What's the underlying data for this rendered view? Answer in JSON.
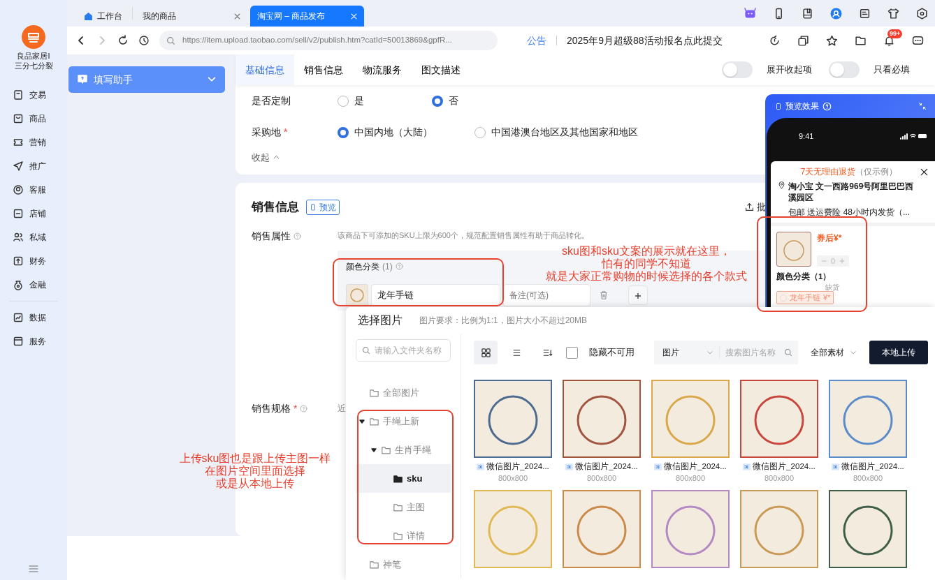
{
  "sidebar": {
    "shop_name": "良品家居I\n三分七分裂",
    "nav_groups": [
      {
        "items": [
          {
            "label": "交易"
          },
          {
            "label": "商品"
          },
          {
            "label": "营销"
          },
          {
            "label": "推广"
          },
          {
            "label": "客服"
          },
          {
            "label": "店铺"
          },
          {
            "label": "私域"
          },
          {
            "label": "财务"
          },
          {
            "label": "金融"
          }
        ]
      },
      {
        "items": [
          {
            "label": "数据"
          },
          {
            "label": "服务"
          }
        ]
      }
    ]
  },
  "browser_tabs": [
    {
      "label": "工作台",
      "selected": false,
      "pinned": true,
      "closable": false
    },
    {
      "label": "我的商品",
      "selected": false,
      "pinned": false,
      "closable": true
    },
    {
      "label": "淘宝网 – 商品发布",
      "selected": true,
      "pinned": false,
      "closable": true
    }
  ],
  "address_bar": {
    "url": "https://item.upload.taobao.com/sell/v2/publish.htm?catId=50013869&gpfR...",
    "forward_disabled": true,
    "notice_label": "公告",
    "notice_text": "2025年9月超级88活动报名点此提交",
    "badge": "99+"
  },
  "helper": {
    "label": "填写助手"
  },
  "form_tabs": [
    {
      "label": "基础信息",
      "selected": true
    },
    {
      "label": "销售信息",
      "selected": false
    },
    {
      "label": "物流服务",
      "selected": false
    },
    {
      "label": "图文描述",
      "selected": false
    }
  ],
  "toggles": [
    {
      "label": "展开收起项",
      "on": false
    },
    {
      "label": "只看必填",
      "on": false
    }
  ],
  "basic_fields": [
    {
      "label": "是否定制",
      "options": [
        {
          "label": "是",
          "selected": false
        },
        {
          "label": "否",
          "selected": true
        }
      ]
    },
    {
      "label": "采购地",
      "required_mark": "*",
      "options": [
        {
          "label": "中国内地（大陆）",
          "selected": true
        },
        {
          "label": "中国港澳台地区及其他国家和地区",
          "selected": false
        }
      ]
    }
  ],
  "collapse_label": "收起",
  "sales": {
    "title": "销售信息",
    "preview_button": "预览",
    "batch_label": "批",
    "attributes_label": "销售属性",
    "attributes_hint": "该商品下可添加的SKU上限为600个，规范配置销售属性有助于商品转化。",
    "group_title": "颜色分类",
    "group_count": "(1)",
    "sku_value": "龙年手链",
    "note_placeholder": "备注(可选)",
    "specs_label": "销售规格",
    "specs_required_mark": "*",
    "specs_hint": "近"
  },
  "preview": {
    "title": "预览效果",
    "time": "9:41",
    "return_policy": "7天无理由退货",
    "return_note": "（仅示例）",
    "address": "淘小宝 文一西路969号阿里巴巴西溪园区",
    "shipping": "包邮 送运费险 48小时内发货（...",
    "price": "券后¥*",
    "quantity": "0",
    "group_title": "颜色分类（1）",
    "chip_label": "龙年手链",
    "chip_price": "¥*",
    "stock_note": "缺货"
  },
  "dialog": {
    "title": "选择图片",
    "requirement": "图片要求：比例为1:1，图片大小不超过20MB",
    "folder_search_placeholder": "请输入文件夹名称",
    "folders": [
      {
        "label": "全部图片",
        "selected": false
      },
      {
        "label": "手绳上新",
        "selected": false,
        "expanded": true,
        "children": [
          {
            "label": "生肖手绳",
            "selected": false,
            "expanded": true,
            "children": [
              {
                "label": "sku",
                "selected": true
              },
              {
                "label": "主图",
                "selected": false
              },
              {
                "label": "详情",
                "selected": false
              }
            ]
          }
        ]
      },
      {
        "label": "神笔",
        "selected": false
      }
    ],
    "view_modes": [
      {
        "selected": true
      },
      {
        "selected": false
      },
      {
        "selected": false
      }
    ],
    "hide_unavailable": {
      "label": "隐藏不可用",
      "checked": false
    },
    "type_select": "图片",
    "search_placeholder": "搜索图片名称",
    "scope_select": "全部素材",
    "upload_button": "本地上传",
    "images": [
      {
        "name": "微信图片_2024...",
        "size": "800x800",
        "color": "#4d6a8f"
      },
      {
        "name": "微信图片_2024...",
        "size": "800x800",
        "color": "#a0553f"
      },
      {
        "name": "微信图片_2024...",
        "size": "800x800",
        "color": "#d9a84a"
      },
      {
        "name": "微信图片_2024...",
        "size": "800x800",
        "color": "#c8463c"
      },
      {
        "name": "微信图片_2024...",
        "size": "800x800",
        "color": "#5b8cc9"
      },
      {
        "color": "#e0b954"
      },
      {
        "color": "#c98a4a"
      },
      {
        "color": "#b389c4"
      },
      {
        "color": "#c99a55"
      },
      {
        "color": "#3f5e48"
      }
    ]
  },
  "annotations": [
    {
      "lines": [
        "sku图和sku文案的展示就在这里，",
        "怕有的同学不知道",
        "就是大家正常购物的时候选择的各个款式"
      ]
    },
    {
      "lines": [
        "上传sku图也是跟上传主图一样",
        "在图片空间里面选择",
        "或是从本地上传"
      ]
    }
  ]
}
